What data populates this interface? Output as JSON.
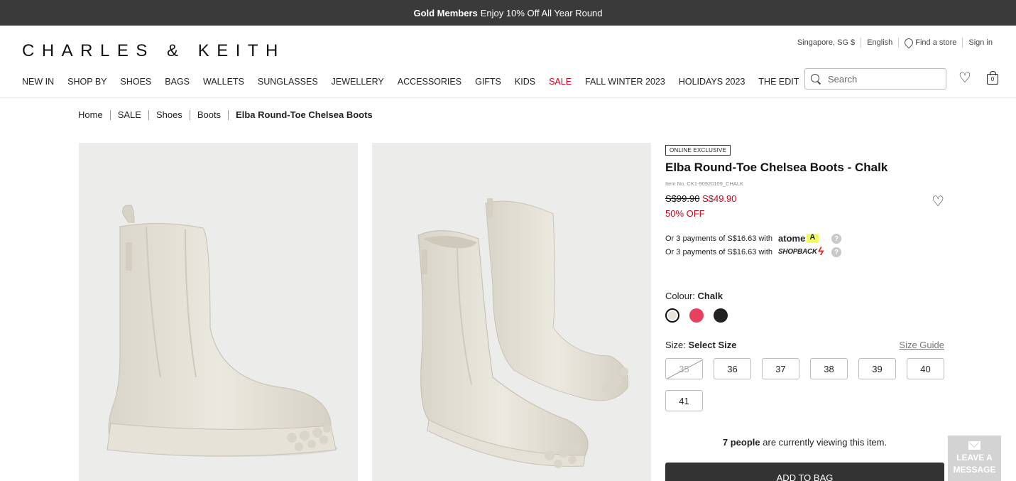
{
  "promo": {
    "bold": "Gold Members",
    "text": "Enjoy 10% Off All Year Round"
  },
  "logo": "CHARLES & KEITH",
  "util": {
    "region": "Singapore, SG $",
    "language": "English",
    "find_store": "Find a store",
    "sign_in": "Sign in"
  },
  "nav": [
    "NEW IN",
    "SHOP BY",
    "SHOES",
    "BAGS",
    "WALLETS",
    "SUNGLASSES",
    "JEWELLERY",
    "ACCESSORIES",
    "GIFTS",
    "KIDS",
    "SALE",
    "FALL WINTER 2023",
    "HOLIDAYS 2023",
    "THE EDIT"
  ],
  "search": {
    "placeholder": "Search"
  },
  "bag_count": "0",
  "breadcrumb": [
    "Home",
    "SALE",
    "Shoes",
    "Boots",
    "Elba Round-Toe Chelsea Boots"
  ],
  "product": {
    "badge": "ONLINE EXCLUSIVE",
    "title": "Elba Round-Toe Chelsea Boots - Chalk",
    "item_no": "Item No. CK1-90920109_CHALK",
    "price_old": "S$99.90",
    "price_new": "S$49.90",
    "discount": "50% OFF",
    "payments": [
      {
        "text": "Or 3 payments of S$16.63 with",
        "brand": "atome"
      },
      {
        "text": "Or 3 payments of S$16.63 with",
        "brand": "SHOPBACK"
      }
    ],
    "colour_label": "Colour:",
    "colour_value": "Chalk",
    "swatches": [
      {
        "name": "Chalk",
        "color": "#e8e4da",
        "selected": true
      },
      {
        "name": "Pink",
        "color": "#e8405f",
        "selected": false
      },
      {
        "name": "Black",
        "color": "#222222",
        "selected": false
      }
    ],
    "size_label": "Size:",
    "size_value": "Select Size",
    "size_guide": "Size Guide",
    "sizes": [
      {
        "label": "35",
        "available": false
      },
      {
        "label": "36",
        "available": true
      },
      {
        "label": "37",
        "available": true
      },
      {
        "label": "38",
        "available": true
      },
      {
        "label": "39",
        "available": true
      },
      {
        "label": "40",
        "available": true
      },
      {
        "label": "41",
        "available": true
      }
    ],
    "viewers_count": "7 people",
    "viewers_text": "are currently viewing this item.",
    "add_to_bag": "ADD TO BAG"
  },
  "leave_message": "LEAVE A MESSAGE",
  "colors": {
    "sale_red": "#d0021b",
    "promo_bg": "#3a3a3a",
    "button_dark": "#333333"
  }
}
